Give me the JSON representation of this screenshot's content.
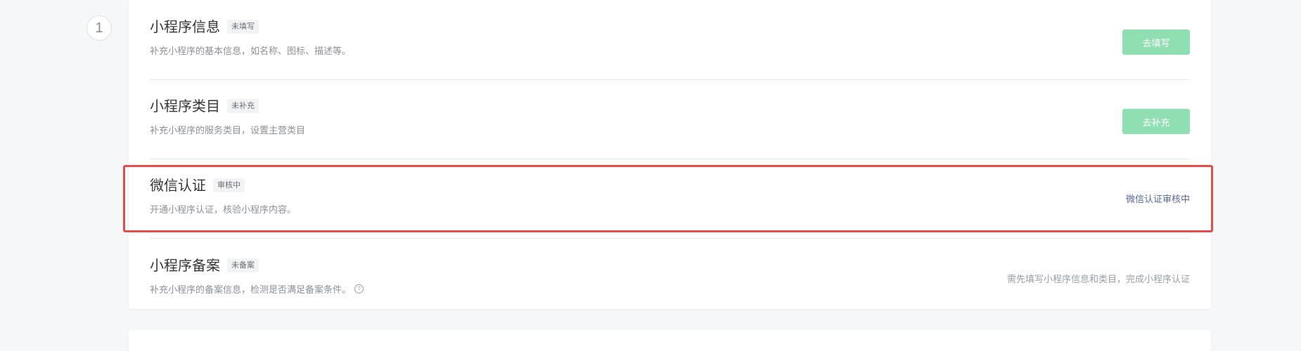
{
  "step": {
    "number": "1"
  },
  "steps": [
    {
      "title": "小程序信息",
      "tag": "未填写",
      "description": "补充小程序的基本信息，如名称、图标、描述等。",
      "action": {
        "type": "button",
        "label": "去填写"
      }
    },
    {
      "title": "小程序类目",
      "tag": "未补充",
      "description": "补充小程序的服务类目，设置主营类目",
      "action": {
        "type": "button",
        "label": "去补充"
      }
    },
    {
      "title": "微信认证",
      "tag": "审核中",
      "description": "开通小程序认证，核验小程序内容。",
      "action": {
        "type": "link",
        "label": "微信认证审核中"
      }
    },
    {
      "title": "小程序备案",
      "tag": "未备案",
      "description": "补充小程序的备案信息，检测是否满足备案条件。",
      "help_icon": "?",
      "action": {
        "type": "text",
        "label": "需先填写小程序信息和类目，完成小程序认证"
      }
    }
  ],
  "colors": {
    "button_bg": "#8fdfb3",
    "link": "#576b95",
    "highlight_border": "#e54d4d"
  }
}
